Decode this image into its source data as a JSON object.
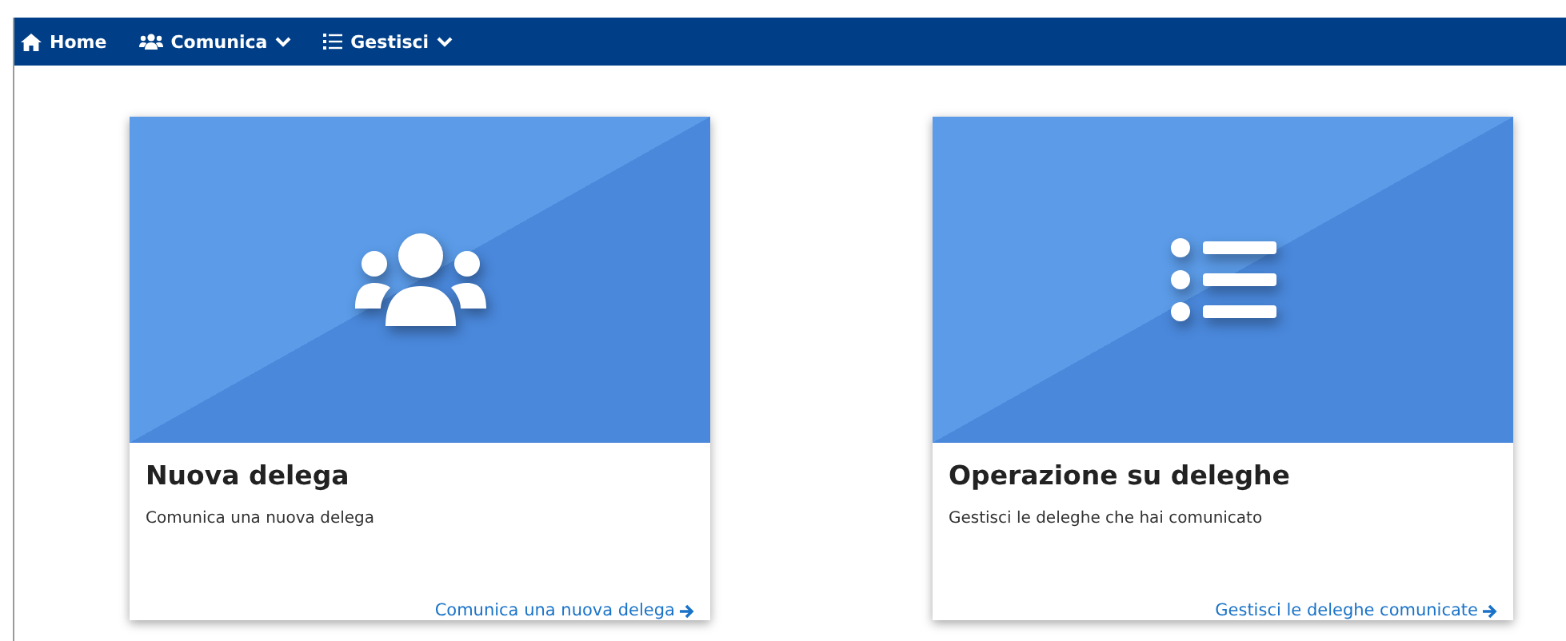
{
  "navbar": {
    "items": [
      {
        "label": "Home",
        "kind": "home",
        "dropdown": false
      },
      {
        "label": "Comunica",
        "kind": "users",
        "dropdown": true
      },
      {
        "label": "Gestisci",
        "kind": "list",
        "dropdown": true
      }
    ]
  },
  "cards": [
    {
      "kind": "users",
      "title": "Nuova delega",
      "text": "Comunica una nuova delega",
      "link": "Comunica una nuova delega"
    },
    {
      "kind": "list",
      "title": "Operazione su deleghe",
      "text": "Gestisci le deleghe che hai comunicato",
      "link": "Gestisci le deleghe comunicate"
    }
  ]
}
